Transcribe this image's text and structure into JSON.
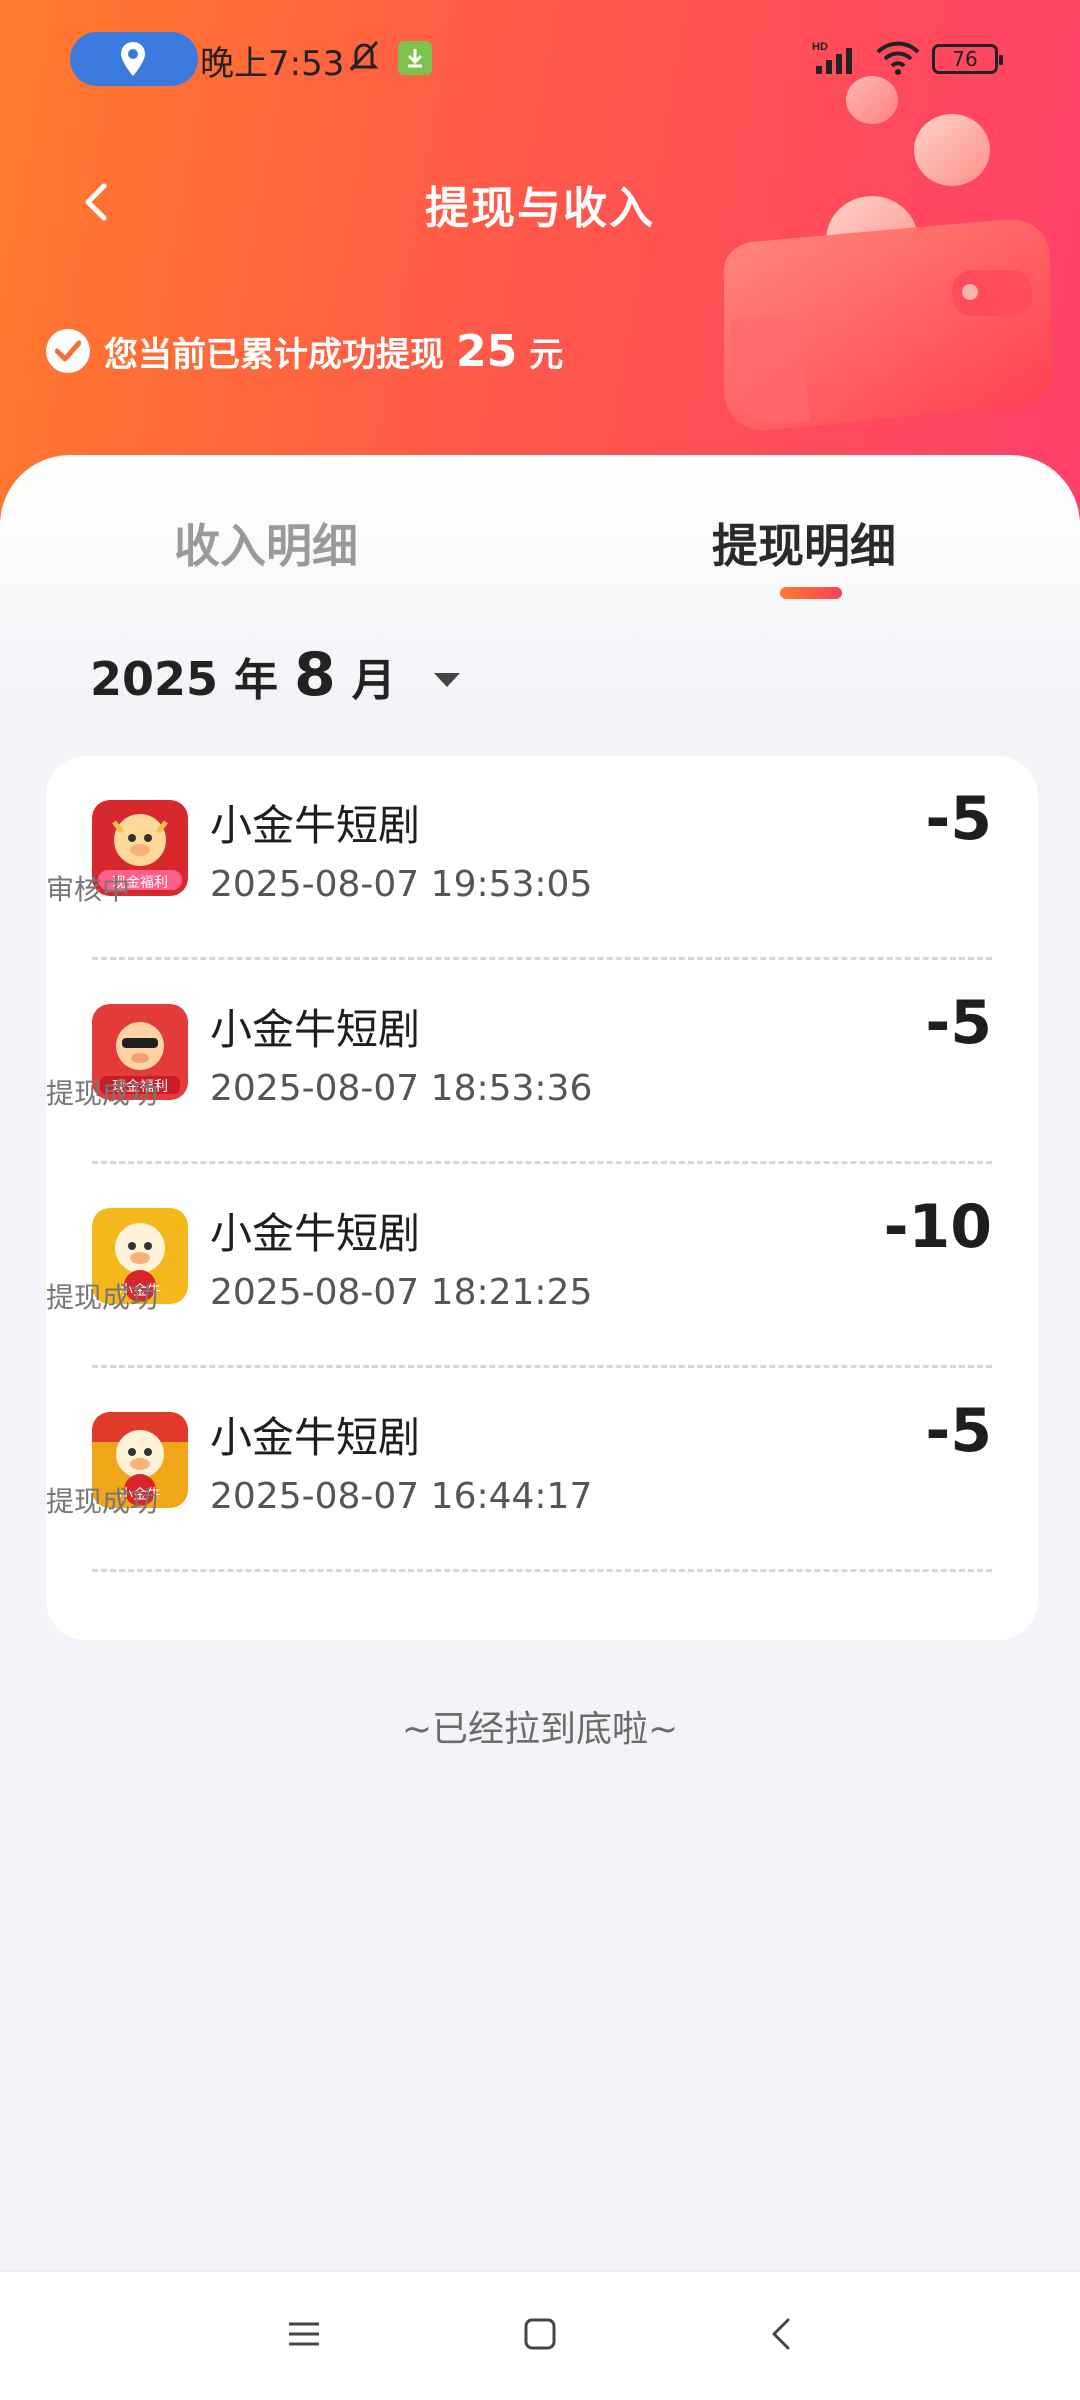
{
  "status_bar": {
    "time": "晚上7:53",
    "battery": "76"
  },
  "header": {
    "title": "提现与收入",
    "summary_text": "您当前已累计成功提现",
    "summary_amount": "25",
    "summary_unit": "元"
  },
  "tabs": [
    {
      "label": "收入明细",
      "active": false
    },
    {
      "label": "提现明细",
      "active": true
    }
  ],
  "month": {
    "year": "2025",
    "year_unit": "年",
    "month": "8",
    "month_unit": "月"
  },
  "records": [
    {
      "name": "小金牛短剧",
      "datetime": "2025-08-07 19:53:05",
      "amount": "-5",
      "status": "审核中",
      "icon_text": "现金福利"
    },
    {
      "name": "小金牛短剧",
      "datetime": "2025-08-07 18:53:36",
      "amount": "-5",
      "status": "提现成功",
      "icon_text": "现金福利"
    },
    {
      "name": "小金牛短剧",
      "datetime": "2025-08-07 18:21:25",
      "amount": "-10",
      "status": "提现成功",
      "icon_text": "小金牛"
    },
    {
      "name": "小金牛短剧",
      "datetime": "2025-08-07 16:44:17",
      "amount": "-5",
      "status": "提现成功",
      "icon_text": "小金牛"
    }
  ],
  "footer_text": "~已经拉到底啦~",
  "colors": {
    "accent_start": "#ff7b2b",
    "accent_end": "#ff3f6a"
  }
}
